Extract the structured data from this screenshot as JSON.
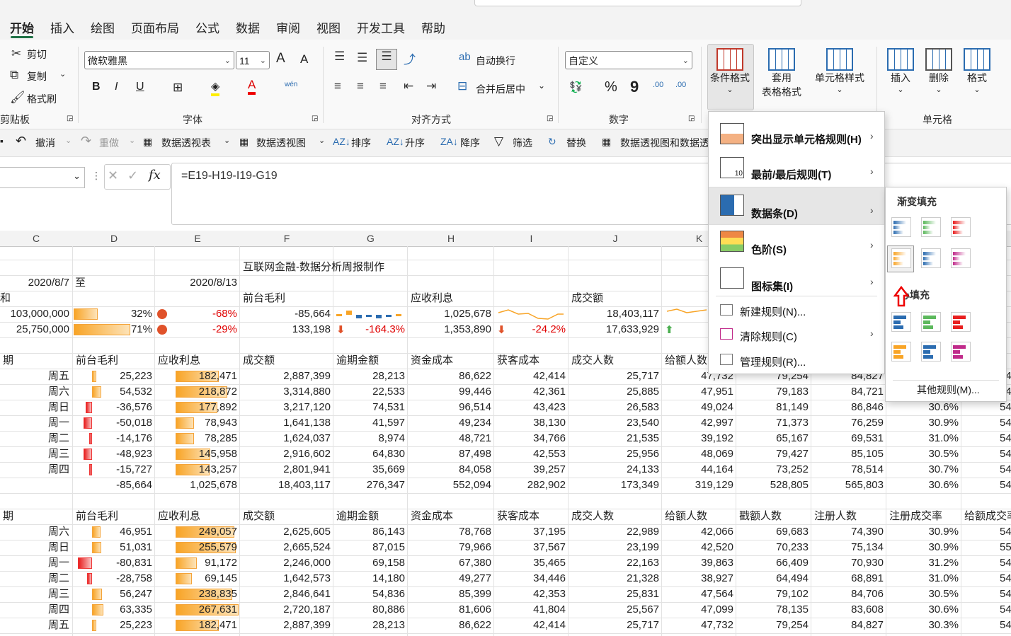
{
  "ribbon_tabs": [
    "开始",
    "插入",
    "绘图",
    "页面布局",
    "公式",
    "数据",
    "审阅",
    "视图",
    "开发工具",
    "帮助"
  ],
  "clipboard": {
    "cut": "剪切",
    "copy": "复制",
    "format_painter": "格式刷",
    "group": "剪贴板"
  },
  "font": {
    "name": "微软雅黑",
    "size": "11",
    "group": "字体",
    "grow": "A",
    "shrink": "A",
    "bold": "B",
    "italic": "I",
    "underline": "U",
    "phonetic": "wén"
  },
  "alignment": {
    "wrap": "自动换行",
    "merge": "合并后居中",
    "group": "对齐方式"
  },
  "number": {
    "format": "自定义",
    "percent": "%",
    "comma": "9",
    "inc_decimal": ".00",
    "dec_decimal": ".00",
    "group": "数字"
  },
  "styles": {
    "conditional": "条件格式",
    "table_line1": "套用",
    "table_line2": "表格格式",
    "cell_styles": "单元格样式"
  },
  "cells": {
    "insert": "插入",
    "delete": "删除",
    "format": "格式",
    "group": "单元格"
  },
  "qat": {
    "undo": "撤消",
    "redo": "重做",
    "pivot_table": "数据透视表",
    "pivot_chart": "数据透视图",
    "sort": "排序",
    "asc": "升序",
    "desc": "降序",
    "filter": "筛选",
    "replace": "替换",
    "pivot_both": "数据透视图和数据透"
  },
  "formula_bar": {
    "formula": "=E19-H19-I19-G19",
    "fx": "fx"
  },
  "columns": [
    "C",
    "D",
    "E",
    "F",
    "G",
    "H",
    "I",
    "J",
    "K"
  ],
  "sheet": {
    "title": "互联网金融-数据分析周报制作",
    "date_from": "2020/8/7",
    "to": "至",
    "date_to": "2020/8/13",
    "row3": {
      "c": "和",
      "f": "前台毛利",
      "h": "应收利息",
      "j": "成交额"
    },
    "row4": {
      "c": "103,000,000",
      "d": "32%",
      "e": "-68%",
      "f": "-85,664",
      "h": "1,025,678",
      "j": "18,403,117"
    },
    "row5": {
      "c": "25,750,000",
      "d": "71%",
      "e": "-29%",
      "f": "133,198",
      "g": "-164.3%",
      "h": "1,353,890",
      "i": "-24.2%",
      "j": "17,633,929"
    },
    "headers1": [
      "期",
      "前台毛利",
      "应收利息",
      "成交额",
      "逾期金额",
      "资金成本",
      "获客成本",
      "成交人数",
      "给额人数"
    ],
    "table1": [
      [
        "周五",
        "25,223",
        "182,471",
        "2,887,399",
        "28,213",
        "86,622",
        "42,414",
        "25,717",
        "47,732",
        "79,254",
        "84,827",
        ""
      ],
      [
        "周六",
        "54,532",
        "218,872",
        "3,314,880",
        "22,533",
        "99,446",
        "42,361",
        "25,885",
        "47,951",
        "79,183",
        "84,721",
        ""
      ],
      [
        "周日",
        "-36,576",
        "177,892",
        "3,217,120",
        "74,531",
        "96,514",
        "43,423",
        "26,583",
        "49,024",
        "81,149",
        "86,846",
        "30.6%"
      ],
      [
        "周一",
        "-50,018",
        "78,943",
        "1,641,138",
        "41,597",
        "49,234",
        "38,130",
        "23,540",
        "42,997",
        "71,373",
        "76,259",
        "30.9%"
      ],
      [
        "周二",
        "-14,176",
        "78,285",
        "1,624,037",
        "8,974",
        "48,721",
        "34,766",
        "21,535",
        "39,192",
        "65,167",
        "69,531",
        "31.0%"
      ],
      [
        "周三",
        "-48,923",
        "145,958",
        "2,916,602",
        "64,830",
        "87,498",
        "42,553",
        "25,956",
        "48,069",
        "79,427",
        "85,105",
        "30.5%"
      ],
      [
        "周四",
        "-15,727",
        "143,257",
        "2,801,941",
        "35,669",
        "84,058",
        "39,257",
        "24,133",
        "44,164",
        "73,252",
        "78,514",
        "30.7%"
      ]
    ],
    "total1": [
      "-85,664",
      "1,025,678",
      "18,403,117",
      "276,347",
      "552,094",
      "282,902",
      "173,349",
      "319,129",
      "528,805",
      "565,803",
      "30.6%"
    ],
    "headers2": [
      "期",
      "前台毛利",
      "应收利息",
      "成交额",
      "逾期金额",
      "资金成本",
      "获客成本",
      "成交人数",
      "给额人数",
      "戳额人数",
      "注册人数",
      "注册成交率",
      "给额成交率"
    ],
    "table2": [
      [
        "周六",
        "46,951",
        "249,057",
        "2,625,605",
        "86,143",
        "78,768",
        "37,195",
        "22,989",
        "42,066",
        "69,683",
        "74,390",
        "30.9%"
      ],
      [
        "周日",
        "51,031",
        "255,579",
        "2,665,524",
        "87,015",
        "79,966",
        "37,567",
        "23,199",
        "42,520",
        "70,233",
        "75,134",
        "30.9%"
      ],
      [
        "周一",
        "-80,831",
        "91,172",
        "2,246,000",
        "69,158",
        "67,380",
        "35,465",
        "22,163",
        "39,863",
        "66,409",
        "70,930",
        "31.2%"
      ],
      [
        "周二",
        "-28,758",
        "69,145",
        "1,642,573",
        "14,180",
        "49,277",
        "34,446",
        "21,328",
        "38,927",
        "64,494",
        "68,891",
        "31.0%"
      ],
      [
        "周三",
        "56,247",
        "238,835",
        "2,846,641",
        "54,836",
        "85,399",
        "42,353",
        "25,831",
        "47,564",
        "79,102",
        "84,706",
        "30.5%"
      ],
      [
        "周四",
        "63,335",
        "267,631",
        "2,720,187",
        "80,886",
        "81,606",
        "41,804",
        "25,567",
        "47,099",
        "78,135",
        "83,608",
        "30.6%"
      ],
      [
        "周五",
        "25,223",
        "182,471",
        "2,887,399",
        "28,213",
        "86,622",
        "42,414",
        "25,717",
        "47,732",
        "79,254",
        "84,827",
        "30.3%"
      ]
    ],
    "right_edge": [
      "54",
      "54",
      "54",
      "54",
      "54",
      "54",
      "54",
      "54",
      "54",
      "55",
      "54",
      "54",
      "54",
      "54"
    ]
  },
  "cf_menu": {
    "items": [
      "突出显示单元格规则(H)",
      "最前/最后规则(T)",
      "数据条(D)",
      "色阶(S)",
      "图标集(I)"
    ],
    "small_items": [
      "新建规则(N)...",
      "清除规则(C)",
      "管理规则(R)..."
    ],
    "top10_label": "10"
  },
  "databar_menu": {
    "gradient": "渐变填充",
    "solid": "实心填充",
    "solid_partial": "心填充",
    "more": "其他规则(M)..."
  },
  "colors": {
    "accent": "#1e7145",
    "orange": "#f8a426",
    "red": "#e81e1e",
    "blue": "#2b6cb0",
    "green": "#5cb85c",
    "purple": "#c02a8a"
  }
}
